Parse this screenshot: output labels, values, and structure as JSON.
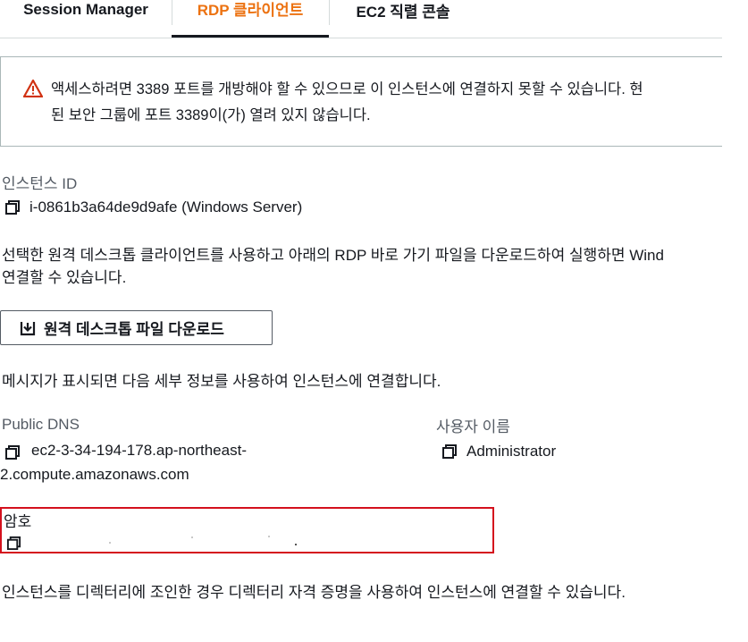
{
  "tabs": [
    {
      "label": "Session Manager"
    },
    {
      "label": "RDP 클라이언트"
    },
    {
      "label": "EC2 직렬 콘솔"
    }
  ],
  "alert": {
    "line1": "액세스하려면 3389 포트를 개방해야 할 수 있으므로 이 인스턴스에 연결하지 못할 수 있습니다. 현",
    "line2": "된 보안 그룹에 포트 3389이(가) 열려 있지 않습니다.",
    "icon": "warning-icon",
    "icon_color": "#d13212"
  },
  "instance": {
    "label": "인스턴스 ID",
    "value": "i-0861b3a64de9d9afe (Windows Server)"
  },
  "description": {
    "line1": "선택한 원격 데스크톱 클라이언트를 사용하고 아래의 RDP 바로 가기 파일을 다운로드하여 실행하면 Wind",
    "line2": "연결할 수 있습니다."
  },
  "download_button": {
    "label": "원격 데스크톱 파일 다운로드",
    "icon": "download-icon"
  },
  "prompt_text": "메시지가 표시되면 다음 세부 정보를 사용하여 인스턴스에 연결합니다.",
  "public_dns": {
    "label": "Public DNS",
    "value_line1": "ec2-3-34-194-178.ap-northeast-",
    "value_line2": "2.compute.amazonaws.com"
  },
  "username": {
    "label": "사용자 이름",
    "value": "Administrator"
  },
  "password": {
    "label": "암호"
  },
  "footer_text": "인스턴스를 디렉터리에 조인한 경우 디렉터리 자격 증명을 사용하여 인스턴스에 연결할 수 있습니다.",
  "colors": {
    "accent": "#ec7211",
    "highlight_border": "#d4111d"
  }
}
